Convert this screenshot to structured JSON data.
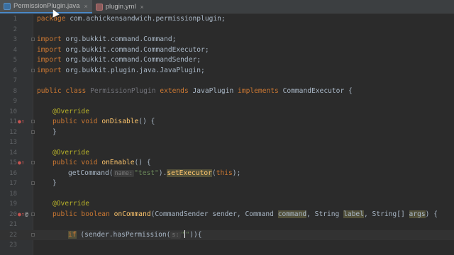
{
  "tabs": [
    {
      "label": "PermissionPlugin.java",
      "active": true,
      "close": "×",
      "icon": "java-file-icon"
    },
    {
      "label": "plugin.yml",
      "active": false,
      "close": "×",
      "icon": "yaml-file-icon"
    }
  ],
  "lines": [
    "1",
    "2",
    "3",
    "4",
    "5",
    "6",
    "7",
    "8",
    "9",
    "10",
    "11",
    "12",
    "13",
    "14",
    "15",
    "16",
    "17",
    "18",
    "19",
    "20",
    "21",
    "22",
    "23"
  ],
  "code": {
    "l1": [
      "package",
      " com.achickensandwich.permissionplugin;"
    ],
    "l3": [
      "import",
      " org.bukkit.command.Command;"
    ],
    "l4": [
      "import",
      " org.bukkit.command.CommandExecutor;"
    ],
    "l5": [
      "import",
      " org.bukkit.command.CommandSender;"
    ],
    "l6": [
      "import",
      " org.bukkit.plugin.java.JavaPlugin;"
    ],
    "l8": [
      "public class ",
      "PermissionPlugin",
      " extends ",
      "JavaPlugin",
      " implements ",
      "CommandExecutor {"
    ],
    "l10": [
      "@Override"
    ],
    "l11": [
      "public void ",
      "onDisable",
      "() {"
    ],
    "l12": [
      "}"
    ],
    "l14": [
      "@Override"
    ],
    "l15": [
      "public void ",
      "onEnable",
      "() {"
    ],
    "l16": [
      "getCommand(",
      "name:",
      "\"test\"",
      ").",
      "setExecutor",
      "(",
      "this",
      ");"
    ],
    "l17": [
      "}"
    ],
    "l19": [
      "@Override"
    ],
    "l20": [
      "public boolean ",
      "onCommand",
      "(CommandSender sender, Command ",
      "command",
      ", String ",
      "label",
      ", String[] ",
      "args",
      ") {"
    ],
    "l22": [
      "if",
      " (sender.hasPermission(",
      "s:",
      "\"",
      "\"",
      ")){"
    ]
  },
  "gutter_icons": {
    "l11": "override-icon",
    "l15": "override-icon",
    "l20": "override-icon",
    "l20b": "@"
  },
  "colors": {
    "keyword": "#cc7832",
    "annotation": "#bbb529",
    "method": "#ffc66d",
    "string": "#6a8759",
    "text": "#a9b7c6",
    "background": "#2b2b2b"
  }
}
